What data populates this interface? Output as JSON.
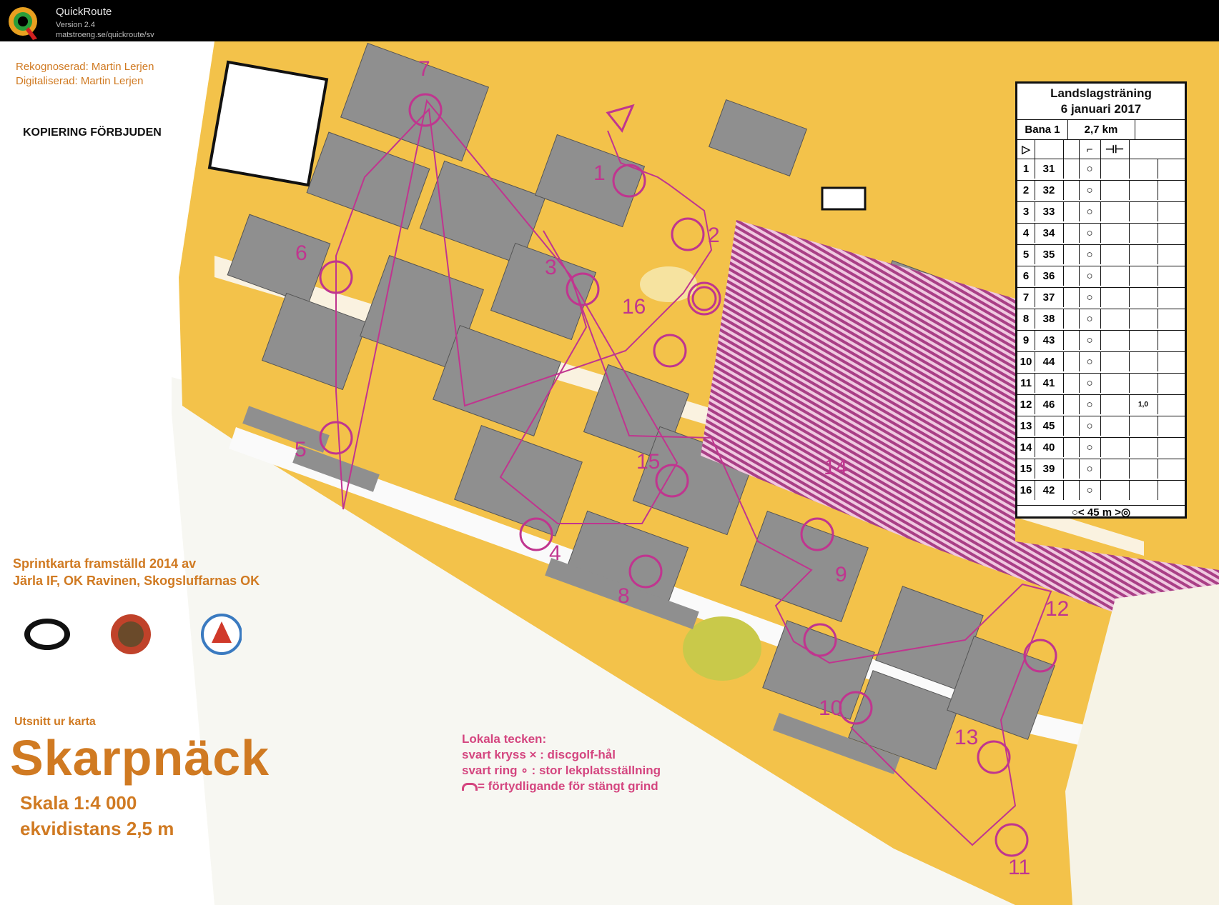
{
  "app": {
    "name": "QuickRoute",
    "version": "Version 2.4",
    "url": "matstroeng.se/quickroute/sv"
  },
  "map": {
    "credits": [
      "Rekognoserad: Martin Lerjen",
      "Digitaliserad: Martin Lerjen"
    ],
    "copy_notice": "KOPIERING FÖRBJUDEN",
    "made_by": [
      "Sprintkarta framställd 2014 av",
      "Järla IF, OK Ravinen, Skogsluffarnas OK"
    ],
    "excerpt": "Utsnitt ur karta",
    "place": "Skarpnäck",
    "scale": "Skala 1:4 000",
    "equidistance": "ekvidistans 2,5 m",
    "local_symbols_title": "Lokala tecken:",
    "local_symbols": [
      "svart kryss  × : discgolf-hål",
      "svart ring  ∘ : stor lekplatsställning",
      "= förtydligande för stängt grind"
    ],
    "logos": [
      "Järla IF",
      "OK Ravinen",
      "Skogsluffarnas OK"
    ],
    "controls": [
      "1",
      "2",
      "3",
      "4",
      "5",
      "6",
      "7",
      "8",
      "9",
      "10",
      "11",
      "12",
      "13",
      "14",
      "15",
      "16"
    ]
  },
  "description_sheet": {
    "title": "Landslagsträning",
    "date": "6 januari 2017",
    "course": "Bana 1",
    "length": "2,7 km",
    "rows": [
      {
        "num": "1",
        "code": "31"
      },
      {
        "num": "2",
        "code": "32"
      },
      {
        "num": "3",
        "code": "33"
      },
      {
        "num": "4",
        "code": "34"
      },
      {
        "num": "5",
        "code": "35"
      },
      {
        "num": "6",
        "code": "36"
      },
      {
        "num": "7",
        "code": "37"
      },
      {
        "num": "8",
        "code": "38"
      },
      {
        "num": "9",
        "code": "43"
      },
      {
        "num": "10",
        "code": "44"
      },
      {
        "num": "11",
        "code": "41"
      },
      {
        "num": "12",
        "code": "46",
        "extra": "1,0"
      },
      {
        "num": "13",
        "code": "45"
      },
      {
        "num": "14",
        "code": "40"
      },
      {
        "num": "15",
        "code": "39"
      },
      {
        "num": "16",
        "code": "42"
      }
    ],
    "finish_distance": "45 m"
  },
  "colors": {
    "course_magenta": "#c0358f",
    "text_orange": "#d07a22",
    "building_gray": "#8e8e8e",
    "open_yellow": "#f2b524",
    "forbidden_purple": "#b0428e"
  }
}
